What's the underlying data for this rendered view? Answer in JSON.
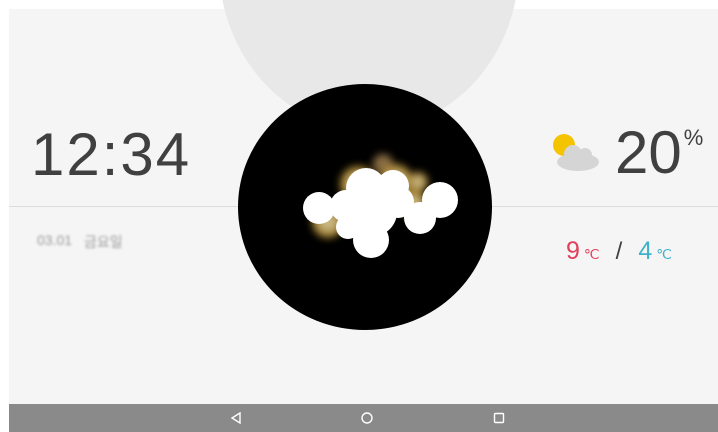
{
  "clock": {
    "time": "12:34"
  },
  "date": {
    "date_text": "03.01",
    "weekday_text": "금요일"
  },
  "weather": {
    "icon": "partly-cloudy-icon",
    "current_temp": "20",
    "current_unit": "%",
    "high_temp": "9",
    "high_unit": "℃",
    "separator": "/",
    "low_temp": "4",
    "low_unit": "℃"
  },
  "nav": {
    "back_icon": "back-triangle-icon",
    "home_icon": "home-circle-icon",
    "recents_icon": "recents-square-icon"
  },
  "colors": {
    "high": "#e0405a",
    "low": "#3fb1c9",
    "sun": "#f5c400",
    "cloud": "#d5d5d5",
    "nav_bar": "#8a8a8a"
  }
}
